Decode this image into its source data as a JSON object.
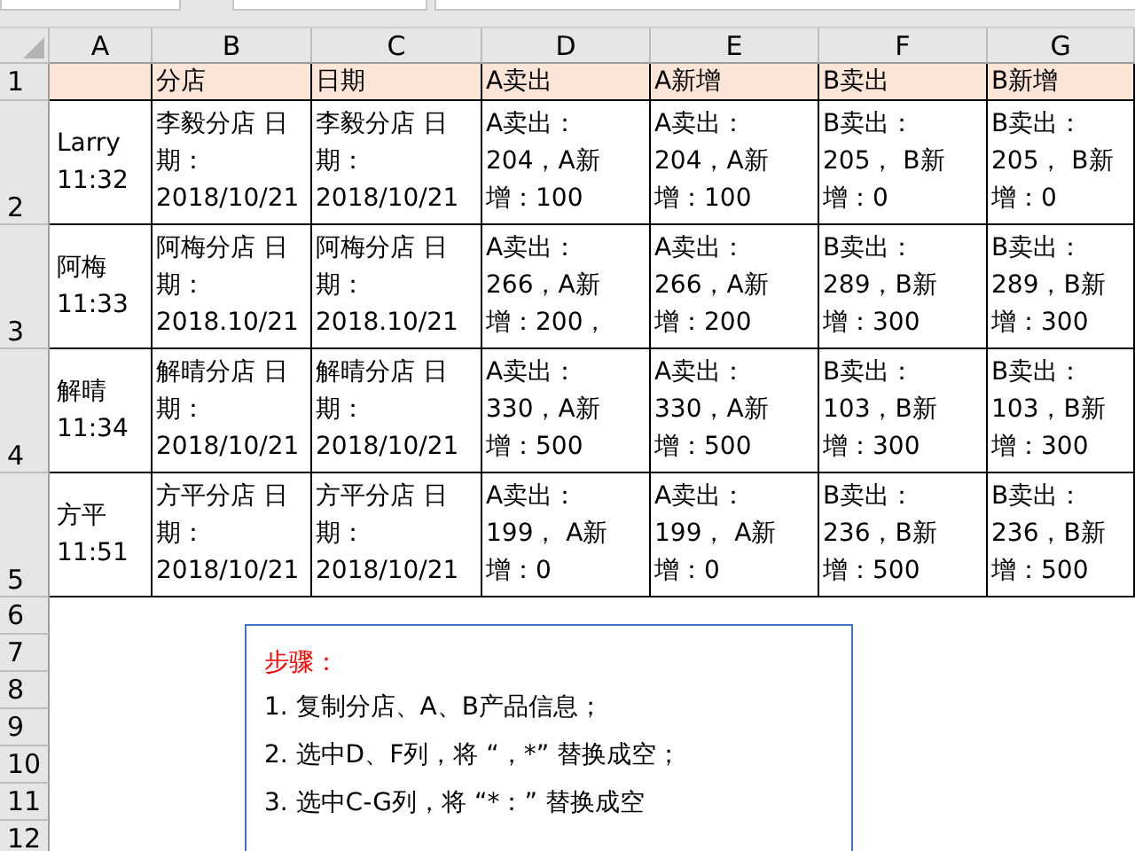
{
  "column_headers": [
    "A",
    "B",
    "C",
    "D",
    "E",
    "F",
    "G"
  ],
  "rows": [
    {
      "number": "1",
      "cells": [
        "",
        "分店",
        "日期",
        "A卖出",
        "A新增",
        "B卖出",
        "B新增"
      ]
    },
    {
      "number": "2",
      "cells": [
        "Larry 11:32",
        "李毅分店 日期：2018/10/21",
        "李毅分店 日期：2018/10/21",
        "A卖出：204，A新增：100",
        "A卖出：204，A新增：100",
        "B卖出：205， B新增：0",
        "B卖出：205， B新增：0"
      ]
    },
    {
      "number": "3",
      "cells": [
        "阿梅 11:33",
        "阿梅分店 日期：2018.10/21",
        "阿梅分店 日期：2018.10/21",
        "A卖出：266，A新增：200，",
        "A卖出：266，A新增：200",
        "B卖出：289，B新增：300",
        "B卖出：289，B新增：300"
      ]
    },
    {
      "number": "4",
      "cells": [
        "解晴 11:34",
        "解晴分店 日期：2018/10/21",
        "解晴分店 日期：2018/10/21",
        "A卖出：330，A新增：500",
        "A卖出：330，A新增：500",
        "B卖出：103，B新增：300",
        "B卖出：103，B新增：300"
      ]
    },
    {
      "number": "5",
      "cells": [
        "方平 11:51",
        "方平分店 日期：2018/10/21",
        "方平分店 日期：2018/10/21",
        "A卖出：199， A新增：0",
        "A卖出：199， A新增：0",
        "B卖出：236，B新增：500",
        "B卖出：236，B新增：500"
      ]
    }
  ],
  "empty_rows": [
    "6",
    "7",
    "8",
    "9",
    "10",
    "11",
    "12"
  ],
  "note": {
    "title": "步骤：",
    "lines": [
      "1. 复制分店、A、B产品信息；",
      "2. 选中D、F列，将 “，*” 替换成空；",
      "3. 选中C-G列，将 “*：” 替换成空"
    ]
  }
}
